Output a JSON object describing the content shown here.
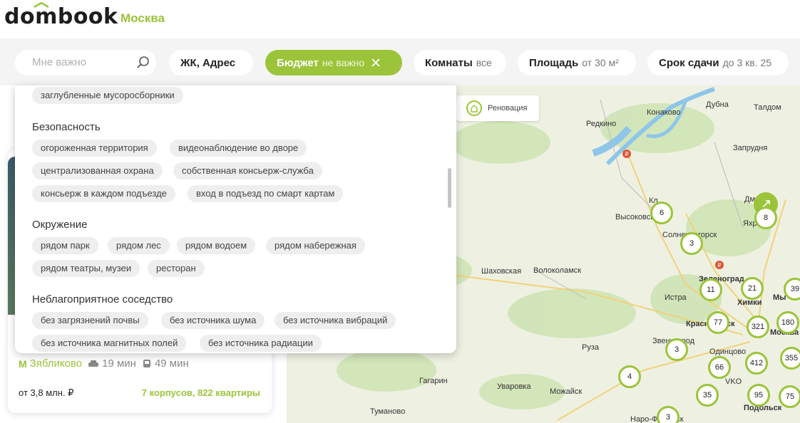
{
  "header": {
    "logo": "dombook",
    "city": "Москва"
  },
  "filters": {
    "search_placeholder": "Мне важно",
    "address": "ЖК, Адрес",
    "budget": {
      "label": "Бюджет",
      "value": "не важно"
    },
    "rooms": {
      "label": "Комнаты",
      "value": "все"
    },
    "area": {
      "label": "Площадь",
      "value": "от 30 м²"
    },
    "deadline": {
      "label": "Срок сдачи",
      "value": "до 3 кв. 25"
    }
  },
  "dropdown": {
    "top_tag": "заглубленные мусоросборники",
    "sections": [
      {
        "title": "Безопасность",
        "tags": [
          "огороженная территория",
          "видеонаблюдение во дворе",
          "централизованная охрана",
          "собственная консьерж-служба",
          "консьерж в каждом подъезде",
          "вход в подъезд по смарт картам"
        ]
      },
      {
        "title": "Окружение",
        "tags": [
          "рядом парк",
          "рядом лес",
          "рядом водоем",
          "рядом набережная",
          "рядом театры, музеи",
          "ресторан"
        ]
      },
      {
        "title": "Неблагоприятное соседство",
        "tags": [
          "без загрязнений почвы",
          "без источника шума",
          "без источника вибраций",
          "без источника магнитных полей",
          "без источника радиации"
        ]
      }
    ]
  },
  "card": {
    "metro": "Зябликово",
    "walk": "19 мин",
    "drive": "49 мин",
    "price": "от 3,8 млн. ₽",
    "buildings": "7 корпусов, 822 квартиры"
  },
  "map": {
    "renovation": "Реновация",
    "labels": [
      "Конаково",
      "Дубна",
      "Талдом",
      "Редкино",
      "Запрудня",
      "Высоковск",
      "Кл",
      "Солнечногорск",
      "Дм",
      "Яхр",
      "Шаховская",
      "Волоколамск",
      "Зеленоград",
      "Истра",
      "Химки",
      "Мы",
      "Красногорск",
      "Москва",
      "Звенигород",
      "Одинцово",
      "Руза",
      "VKO",
      "Гагарин",
      "Уваровка",
      "Можайск",
      "Подольск",
      "Туманово",
      "Наро-Фоминск"
    ],
    "clusters": [
      "6",
      "8",
      "3",
      "11",
      "21",
      "39",
      "77",
      "321",
      "180",
      "3",
      "412",
      "355",
      "66",
      "4",
      "35",
      "95",
      "75",
      "3"
    ]
  },
  "colors": {
    "accent": "#9bc43a",
    "chip_bg": "#ffffff",
    "bar_bg": "#f4f4f4",
    "tag_bg": "#eeeeee"
  }
}
